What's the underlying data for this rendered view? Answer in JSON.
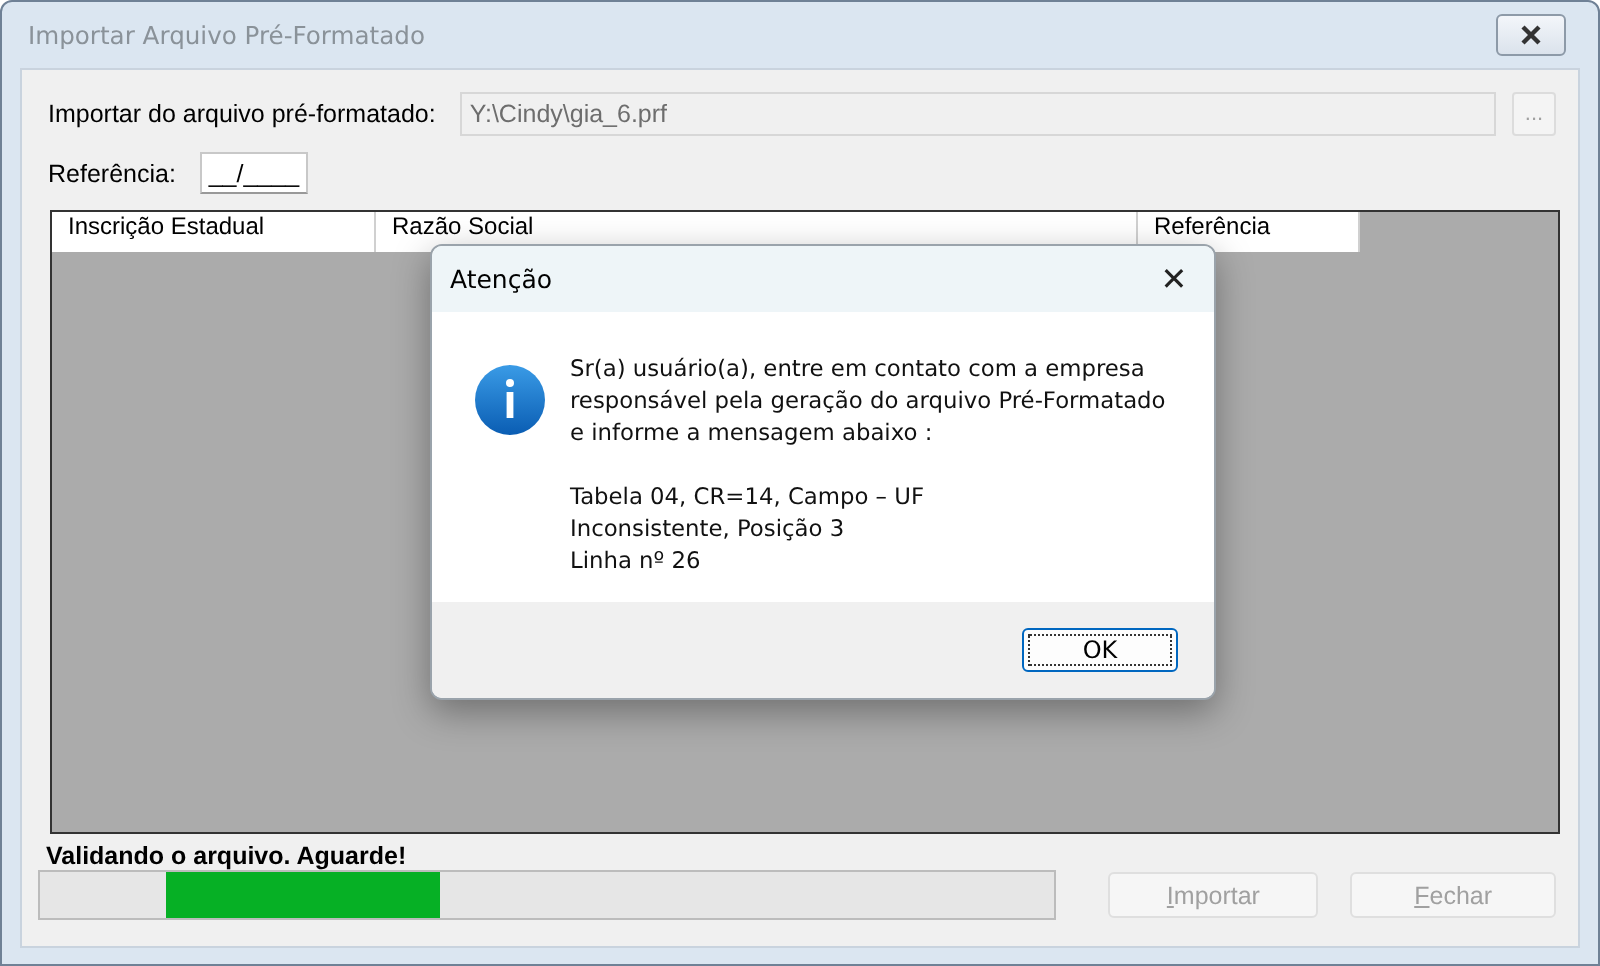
{
  "window": {
    "title": "Importar Arquivo Pré-Formatado",
    "active": false
  },
  "file_row": {
    "label": "Importar do arquivo pré-formatado:",
    "value": "Y:\\Cindy\\gia_6.prf",
    "browse_button": {
      "label": "...",
      "disabled": true
    }
  },
  "reference_row": {
    "label": "Referência:",
    "value": "__/____"
  },
  "table": {
    "columns": [
      "Inscrição Estadual",
      "Razão Social",
      "Referência"
    ]
  },
  "status": {
    "text": "Validando o arquivo. Aguarde!"
  },
  "progress": {
    "level": 0.27
  },
  "buttons": [
    {
      "label": "Importar",
      "disabled": true
    },
    {
      "label": "Fechar",
      "disabled": true
    }
  ],
  "dialog": {
    "title": "Atenção",
    "close": "✕",
    "paragraphs": [
      [
        "Sr(a) usuário(a), entre em contato com a empresa",
        "responsável pela geração do arquivo Pré-Formatado",
        "e informe a mensagem abaixo :"
      ],
      [
        "Tabela 04, CR=14, Campo – UF",
        "Inconsistente, Posição 3",
        "Linha nº 26"
      ]
    ],
    "button": "OK"
  }
}
